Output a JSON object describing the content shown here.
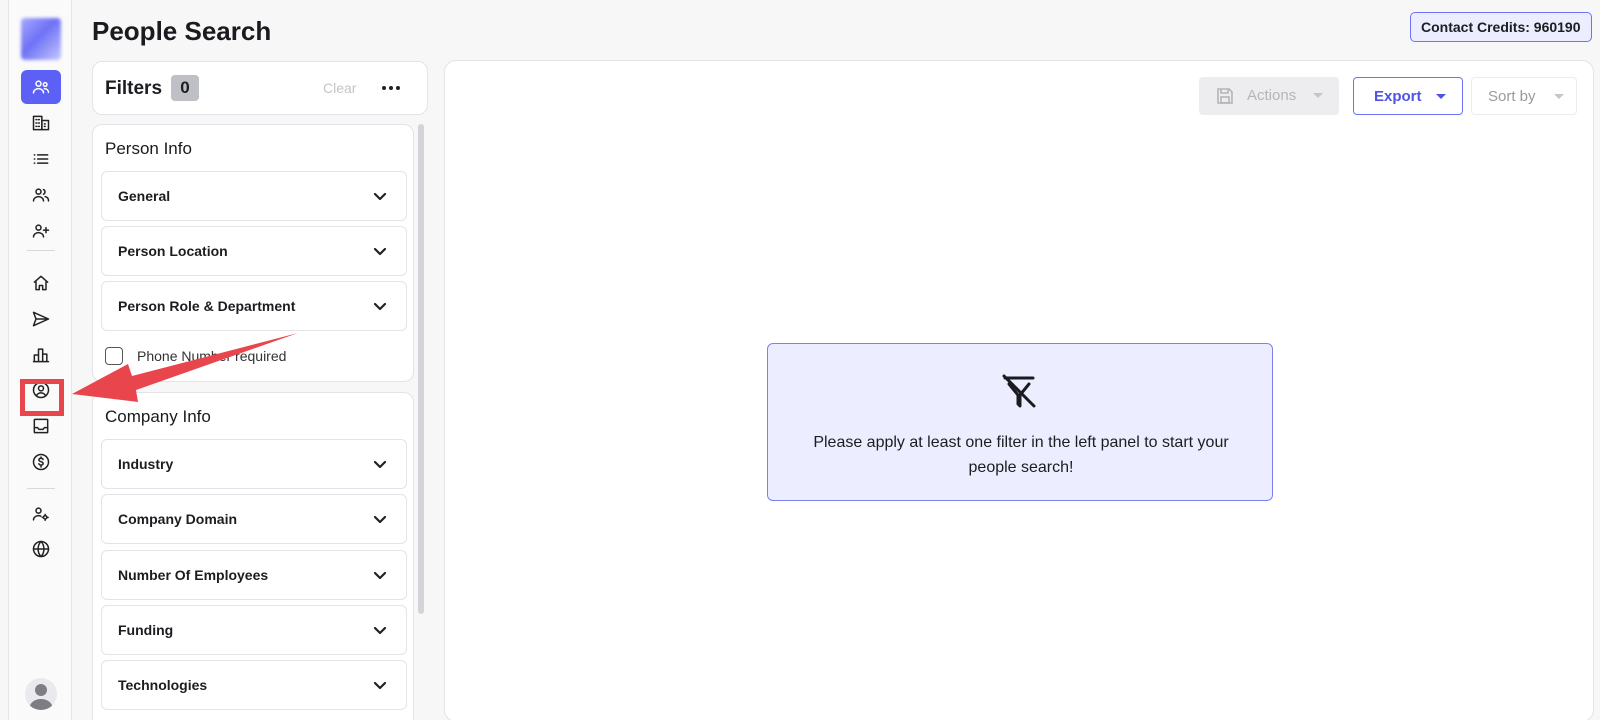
{
  "header": {
    "title": "People Search",
    "credits": "Contact Credits: 960190"
  },
  "rail": {
    "items": [
      {
        "icon": "people-icon",
        "active": true
      },
      {
        "icon": "building-icon"
      },
      {
        "icon": "list-icon"
      },
      {
        "icon": "group-icon"
      },
      {
        "icon": "add-person-icon"
      },
      {
        "icon": "home-icon"
      },
      {
        "icon": "send-icon"
      },
      {
        "icon": "bar-chart-icon"
      },
      {
        "icon": "user-circle-icon"
      },
      {
        "icon": "inbox-icon"
      },
      {
        "icon": "dollar-circle-icon"
      },
      {
        "icon": "user-settings-icon"
      },
      {
        "icon": "globe-icon"
      }
    ]
  },
  "filters": {
    "title": "Filters",
    "count": "0",
    "clear_label": "Clear"
  },
  "person_info": {
    "title": "Person Info",
    "sections": [
      "General",
      "Person Location",
      "Person Role & Department"
    ],
    "phone_required_label": "Phone Number required"
  },
  "company_info": {
    "title": "Company Info",
    "sections": [
      "Industry",
      "Company Domain",
      "Number Of Employees",
      "Funding",
      "Technologies"
    ]
  },
  "toolbar": {
    "actions_label": "Actions",
    "export_label": "Export",
    "sort_label": "Sort by"
  },
  "empty_state": {
    "message": "Please apply at least one filter in the left panel to start your people search!"
  },
  "colors": {
    "accent": "#5c60f5",
    "highlight": "#e8464c"
  }
}
